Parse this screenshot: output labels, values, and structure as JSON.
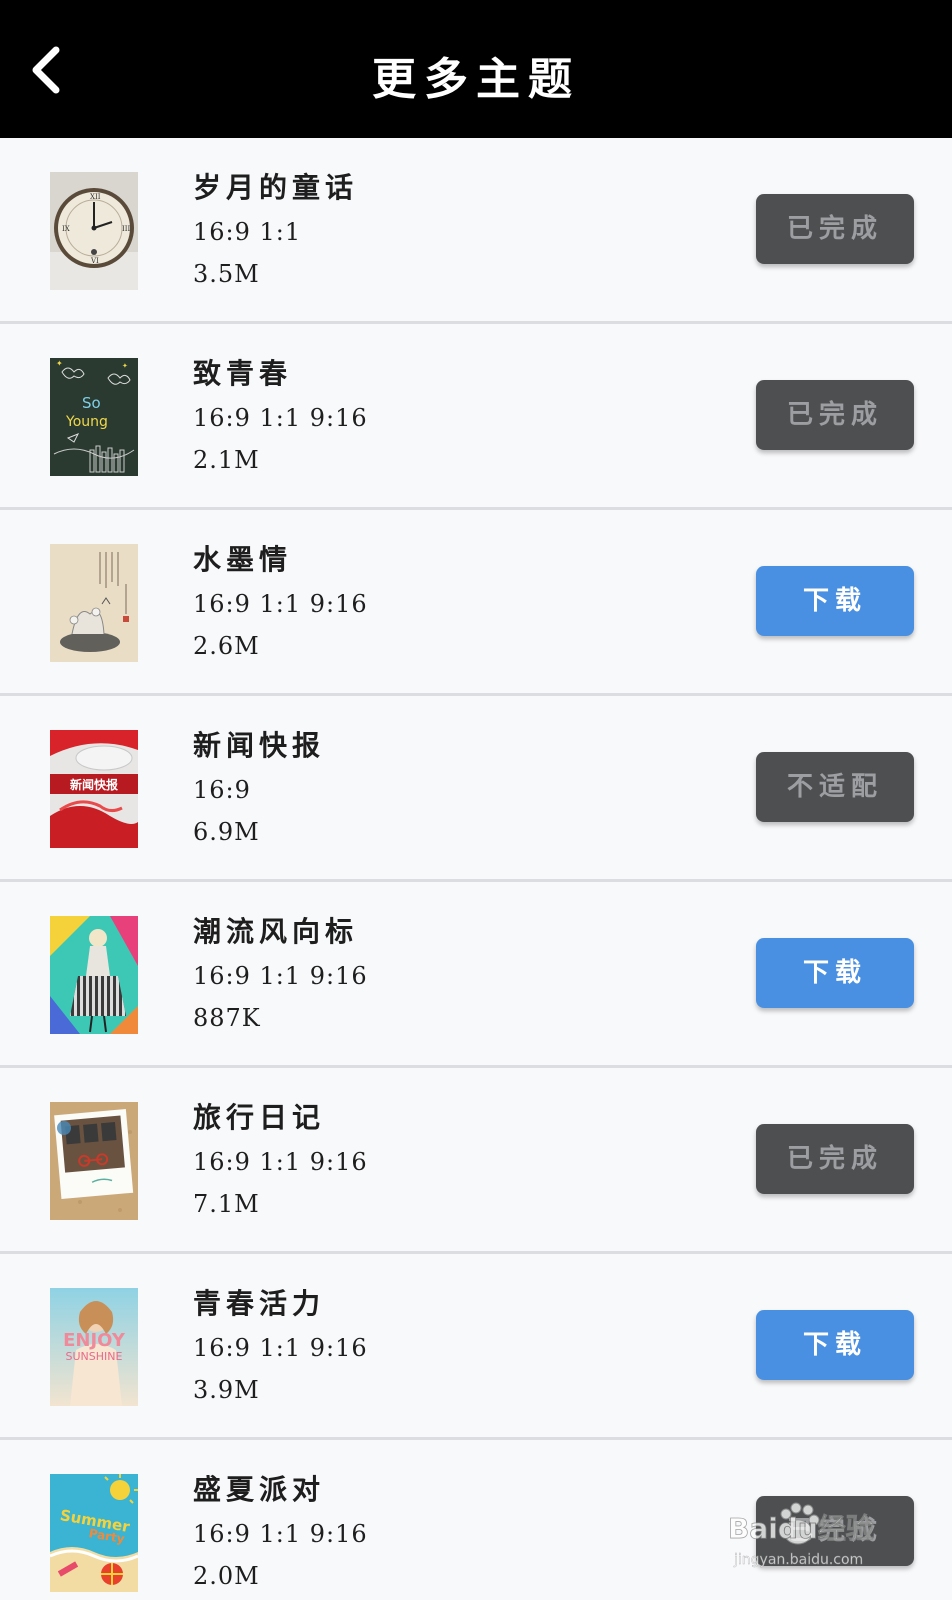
{
  "header": {
    "title": "更多主题",
    "back_icon": "chevron-left-icon"
  },
  "themes": [
    {
      "name": "岁月的童话",
      "ratios": "16:9 1:1",
      "size": "3.5M",
      "action": "已完成",
      "state": "done",
      "thumb": "clock"
    },
    {
      "name": "致青春",
      "ratios": "16:9 1:1 9:16",
      "size": "2.1M",
      "action": "已完成",
      "state": "done",
      "thumb": "chalkboard",
      "thumb_text": [
        "So",
        "Young"
      ]
    },
    {
      "name": "水墨情",
      "ratios": "16:9 1:1 9:16",
      "size": "2.6M",
      "action": "下载",
      "state": "download",
      "thumb": "ink"
    },
    {
      "name": "新闻快报",
      "ratios": "16:9",
      "size": "6.9M",
      "action": "不适配",
      "state": "done",
      "thumb": "news",
      "thumb_text": [
        "新闻快报"
      ]
    },
    {
      "name": "潮流风向标",
      "ratios": "16:9 1:1 9:16",
      "size": "887K",
      "action": "下载",
      "state": "download",
      "thumb": "fashion"
    },
    {
      "name": "旅行日记",
      "ratios": "16:9 1:1 9:16",
      "size": "7.1M",
      "action": "已完成",
      "state": "done",
      "thumb": "travel"
    },
    {
      "name": "青春活力",
      "ratios": "16:9 1:1 9:16",
      "size": "3.9M",
      "action": "下载",
      "state": "download",
      "thumb": "enjoy",
      "thumb_text": [
        "ENJOY",
        "SUNSHINE"
      ]
    },
    {
      "name": "盛夏派对",
      "ratios": "16:9 1:1 9:16",
      "size": "2.0M",
      "action": "已完成",
      "state": "done",
      "thumb": "summer",
      "thumb_text": [
        "Summer",
        "Party"
      ]
    }
  ],
  "colors": {
    "header_bg": "#000000",
    "done_button": "#4d4f51",
    "download_button": "#4a90e2",
    "background": "#f7f8fa"
  },
  "watermark": {
    "text": "Baidu经验",
    "subtext": "jingyan.baidu.com"
  }
}
